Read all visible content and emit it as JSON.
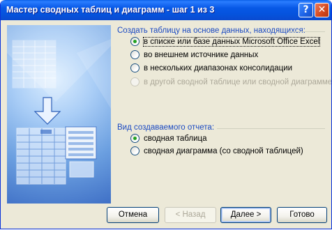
{
  "window": {
    "title": "Мастер сводных таблиц и диаграмм - шаг 1 из 3",
    "help_glyph": "?",
    "close_glyph": "✕"
  },
  "source_group": {
    "label": "Создать таблицу на основе данных, находящихся:",
    "options": [
      {
        "label": "в списке или базе данных Microsoft Office Excel",
        "checked": true,
        "disabled": false
      },
      {
        "label": "во внешнем источнике данных",
        "checked": false,
        "disabled": false
      },
      {
        "label": "в нескольких диапазонах консолидации",
        "checked": false,
        "disabled": false
      },
      {
        "label": "в другой сводной таблице или сводной диаграмме",
        "checked": false,
        "disabled": true
      }
    ]
  },
  "report_group": {
    "label": "Вид создаваемого отчета:",
    "options": [
      {
        "label": "сводная таблица",
        "checked": true,
        "disabled": false
      },
      {
        "label": "сводная диаграмма (со сводной таблицей)",
        "checked": false,
        "disabled": false
      }
    ]
  },
  "buttons": {
    "cancel": "Отмена",
    "back": "< Назад",
    "next": "Далее >",
    "finish": "Готово"
  },
  "colors": {
    "titlebar": "#0758e6",
    "group_label": "#1b4ac2",
    "radio_dot": "#21a121"
  },
  "icons": {
    "graphic": "pivot-wizard-illustration",
    "arrow": "down-arrow-icon"
  }
}
